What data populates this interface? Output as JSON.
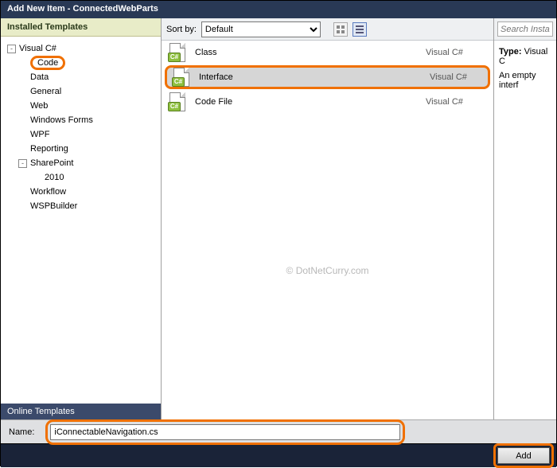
{
  "window": {
    "title": "Add New Item - ConnectedWebParts"
  },
  "sidebar": {
    "header": "Installed Templates",
    "tree": [
      {
        "label": "Visual C#",
        "depth": 0,
        "expander": "-"
      },
      {
        "label": "Code",
        "depth": 1,
        "highlight": true
      },
      {
        "label": "Data",
        "depth": 1
      },
      {
        "label": "General",
        "depth": 1
      },
      {
        "label": "Web",
        "depth": 1
      },
      {
        "label": "Windows Forms",
        "depth": 1
      },
      {
        "label": "WPF",
        "depth": 1
      },
      {
        "label": "Reporting",
        "depth": 1
      },
      {
        "label": "SharePoint",
        "depth": 1,
        "expander": "-"
      },
      {
        "label": "2010",
        "depth": 2
      },
      {
        "label": "Workflow",
        "depth": 1
      },
      {
        "label": "WSPBuilder",
        "depth": 1
      }
    ],
    "online": "Online Templates"
  },
  "toolbar": {
    "sortLabel": "Sort by:",
    "sortValue": "Default"
  },
  "items": [
    {
      "name": "Class",
      "lang": "Visual C#",
      "selected": false
    },
    {
      "name": "Interface",
      "lang": "Visual C#",
      "selected": true
    },
    {
      "name": "Code File",
      "lang": "Visual C#",
      "selected": false
    }
  ],
  "search": {
    "placeholder": "Search Installed"
  },
  "detail": {
    "typeLabel": "Type:",
    "typeValue": "Visual C",
    "desc": "An empty interf"
  },
  "namebar": {
    "label": "Name:",
    "value": "iConnectableNavigation.cs"
  },
  "footer": {
    "add": "Add"
  },
  "watermark": "© DotNetCurry.com",
  "iconBadge": "C#"
}
